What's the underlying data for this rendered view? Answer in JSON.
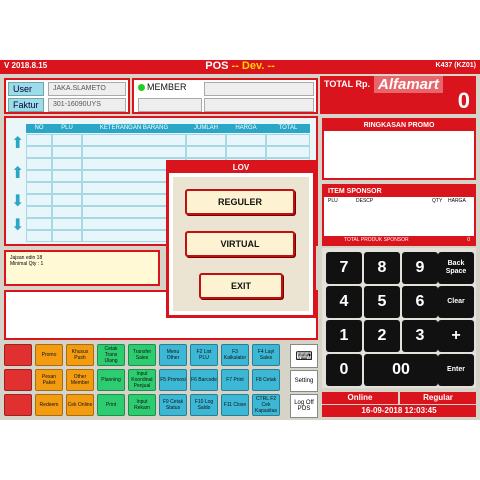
{
  "titlebar": {
    "version": "V 2018.8.15",
    "app": "POS",
    "dev": "-- Dev. --",
    "store_code": "K437 (KZ01)"
  },
  "user": {
    "label": "User",
    "value": "JAKA.SLAMETO"
  },
  "faktur": {
    "label": "Faktur",
    "value": "301-16090UYS"
  },
  "member": {
    "label": "MEMBER"
  },
  "total": {
    "label": "TOTAL Rp.",
    "value": "0",
    "brand": "Alfamart"
  },
  "table": {
    "headers": [
      "NO",
      "PLU",
      "KETERANGAN BARANG",
      "JUMLAH",
      "HARGA",
      "TOTAL"
    ]
  },
  "promo": {
    "title": "RINGKASAN PROMO"
  },
  "sponsor": {
    "title": "ITEM SPONSOR",
    "cols": [
      "PLU",
      "DESCP",
      "QTY",
      "HARGA"
    ],
    "footer": "TOTAL PRODUK SPONSOR",
    "footer_value": "0"
  },
  "info": {
    "line1": "Jajsan edin 18",
    "line2": "Minimal Qty : 1"
  },
  "lov": {
    "title": "LOV",
    "btn1": "REGULER",
    "btn2": "VIRTUAL",
    "btn3": "EXIT"
  },
  "keypad": {
    "k7": "7",
    "k8": "8",
    "k9": "9",
    "back": "Back Space",
    "k4": "4",
    "k5": "5",
    "k6": "6",
    "clear": "Clear",
    "k1": "1",
    "k2": "2",
    "k3": "3",
    "plus": "+",
    "k0": "0",
    "k00": "00",
    "enter": "Enter"
  },
  "fkeys": {
    "r1": [
      "",
      "Promo",
      "Khusus Push",
      "Cetak Trans Ulang",
      "Transfer Sales",
      "Menu Other",
      "F2 List PLU",
      "F3 Kalkulator",
      "F4 Layl Sales"
    ],
    "r2": [
      "",
      "Pesan Paket",
      "Other Member",
      "Planning",
      "Input Koordinat Penjual",
      "F5 Promosi",
      "F6 Barcode",
      "F7 Print",
      "F8 Cetak"
    ],
    "r3": [
      "",
      "Redeem",
      "Cek Online",
      "Print",
      "Input Rekam",
      "F9 Cetak Status",
      "F10 Log Saldo",
      "F11 Close",
      "CTRL F2 Cek Kapasitas"
    ]
  },
  "side": {
    "keyboard": "",
    "setting": "Setting",
    "logoff": "Log Off POS"
  },
  "status": {
    "mode": "Online",
    "type": "Regular",
    "datetime": "16-09-2018  12:03:45"
  }
}
